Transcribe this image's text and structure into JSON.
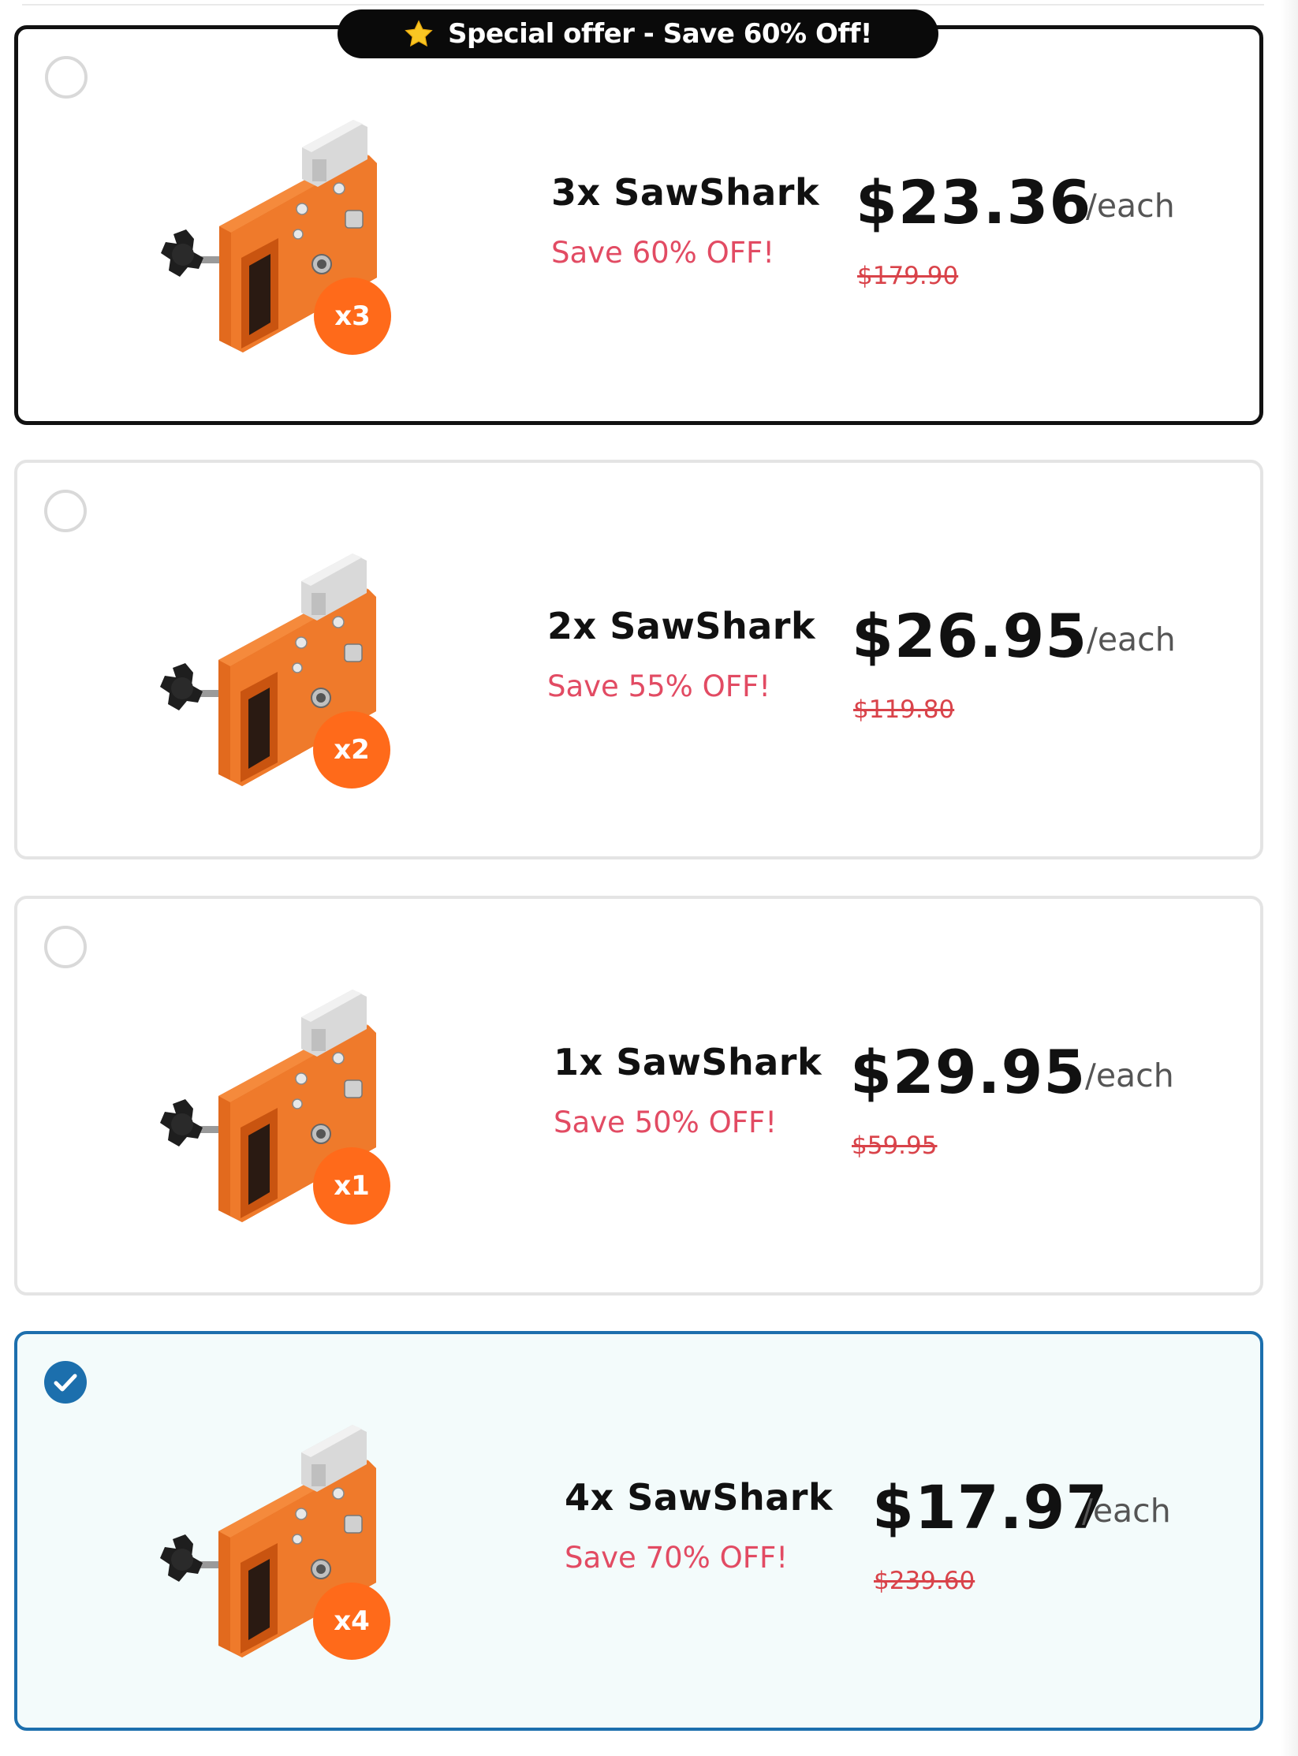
{
  "banner": {
    "label": "Special offer - Save 60% Off!",
    "icon": "star-icon",
    "background": "#0a0a0a"
  },
  "colors": {
    "accent_orange": "#ff6a1a",
    "save_red": "#e24b63",
    "selected_blue": "#1c6fad",
    "selected_bg": "#f3fbfb"
  },
  "offers": [
    {
      "name": "3x SawShark",
      "save": "Save 60% OFF!",
      "price": "$23.36",
      "per": "/each",
      "old_price": "$179.90",
      "qty_badge": "x3",
      "selected": false,
      "featured": true
    },
    {
      "name": "2x SawShark",
      "save": "Save 55% OFF!",
      "price": "$26.95",
      "per": "/each",
      "old_price": "$119.80",
      "qty_badge": "x2",
      "selected": false,
      "featured": false
    },
    {
      "name": "1x SawShark",
      "save": "Save 50% OFF!",
      "price": "$29.95",
      "per": "/each",
      "old_price": "$59.95",
      "qty_badge": "x1",
      "selected": false,
      "featured": false
    },
    {
      "name": "4x SawShark",
      "save": "Save 70% OFF!",
      "price": "$17.97",
      "per": "/each",
      "old_price": "$239.60",
      "qty_badge": "x4",
      "selected": true,
      "featured": false
    }
  ]
}
